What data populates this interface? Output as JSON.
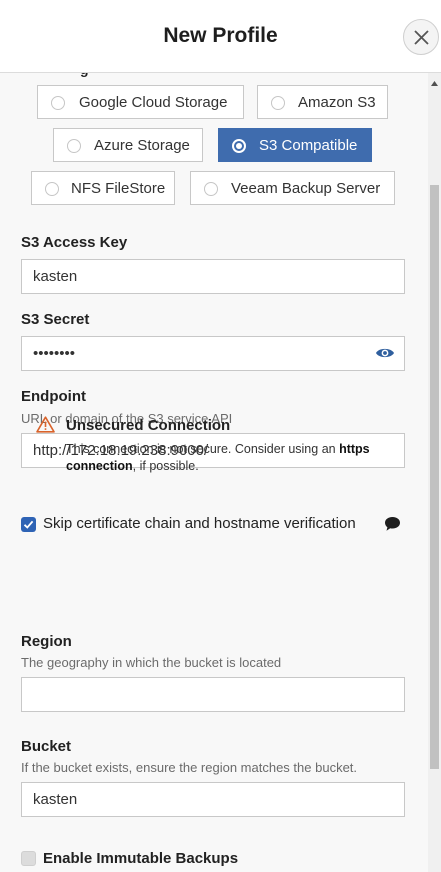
{
  "header": {
    "title": "New Profile"
  },
  "storage": {
    "cut_label": "g",
    "options": [
      {
        "label": "Google Cloud Storage",
        "selected": false
      },
      {
        "label": "Amazon S3",
        "selected": false
      },
      {
        "label": "Azure Storage",
        "selected": false
      },
      {
        "label": "S3 Compatible",
        "selected": true
      },
      {
        "label": "NFS FileStore",
        "selected": false
      },
      {
        "label": "Veeam Backup Server",
        "selected": false
      }
    ]
  },
  "access_key": {
    "label": "S3 Access Key",
    "value": "kasten"
  },
  "secret": {
    "label": "S3 Secret",
    "value": "••••••••"
  },
  "endpoint": {
    "label": "Endpoint",
    "help": "URL or domain of the S3 service API",
    "value": "http://172.18.19.238:9000/"
  },
  "warning": {
    "title": "Unsecured Connection",
    "text_before": "This connection is not secure. Consider using an ",
    "text_bold": "https connection",
    "text_after": ", if possible."
  },
  "skip_verify": {
    "label": "Skip certificate chain and hostname verification",
    "checked": true
  },
  "region": {
    "label": "Region",
    "help": "The geography in which the bucket is located",
    "value": ""
  },
  "bucket": {
    "label": "Bucket",
    "help": "If the bucket exists, ensure the region matches the bucket.",
    "value": "kasten"
  },
  "immutable": {
    "label": "Enable Immutable Backups",
    "checked": false
  },
  "colors": {
    "accent": "#3f6cae",
    "checkbox": "#2e63b5",
    "warning": "#d9632b"
  }
}
